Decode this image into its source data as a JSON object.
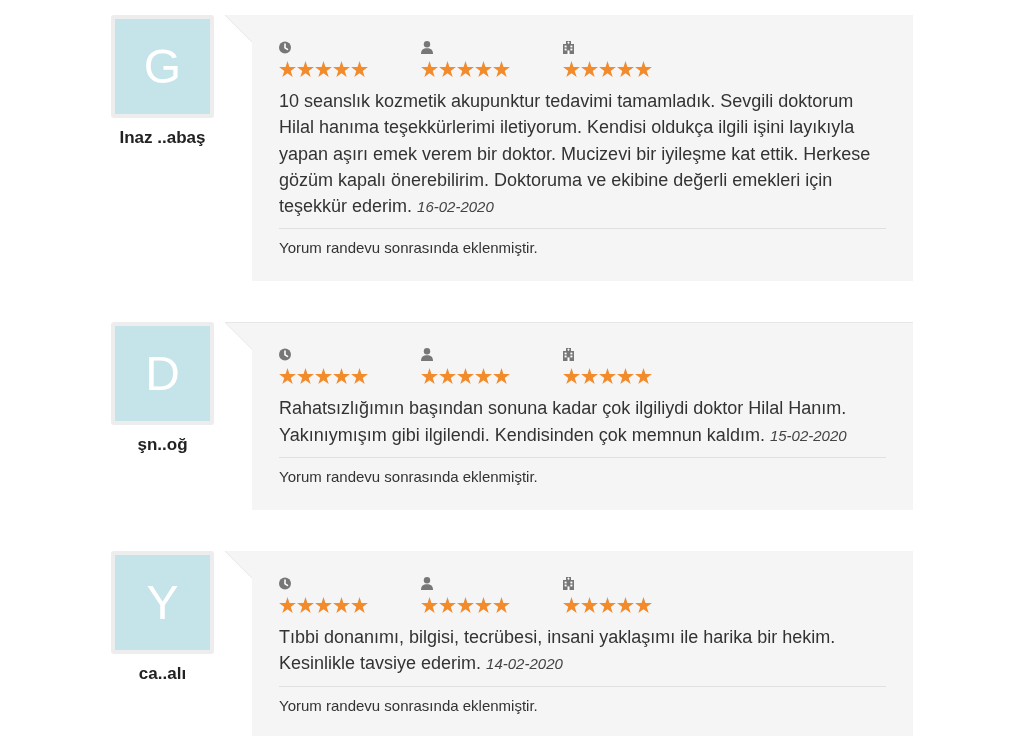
{
  "reviews": [
    {
      "avatar_letter": "G",
      "name": "Inaz ..abaş",
      "ratings": [
        {
          "kind": "clock",
          "stars": 5
        },
        {
          "kind": "person",
          "stars": 5
        },
        {
          "kind": "building",
          "stars": 5
        }
      ],
      "text": "10 seanslık kozmetik akupunktur tedavimi tamamladık. Sevgili doktorum Hilal hanıma teşekkürlerimi iletiyorum. Kendisi oldukça ilgili işini layıkıyla yapan aşırı emek verem bir doktor. Mucizevi bir iyileşme kat ettik. Herkese gözüm kapalı önerebilirim. Doktoruma ve ekibine değerli emekleri için teşekkür ederim. *16-02-2020*",
      "note": "Yorum randevu sonrasında eklenmiştir."
    },
    {
      "avatar_letter": "D",
      "name": "şn..oğ",
      "ratings": [
        {
          "kind": "clock",
          "stars": 5
        },
        {
          "kind": "person",
          "stars": 5
        },
        {
          "kind": "building",
          "stars": 5
        }
      ],
      "text": "Rahatsızlığımın başından sonuna kadar çok ilgiliydi doktor Hilal Hanım. Yakınıymışım gibi ilgilendi. Kendisinden çok memnun kaldım. *15-02-2020*",
      "note": "Yorum randevu sonrasında eklenmiştir."
    },
    {
      "avatar_letter": "Y",
      "name": "ca..alı",
      "ratings": [
        {
          "kind": "clock",
          "stars": 5
        },
        {
          "kind": "person",
          "stars": 5
        },
        {
          "kind": "building",
          "stars": 5
        }
      ],
      "text": "Tıbbi donanımı, bilgisi, tecrübesi, insani yaklaşımı ile harika bir hekim. Kesinlikle tavsiye ederim. *14-02-2020*",
      "note": "Yorum randevu sonrasında eklenmiştir."
    }
  ]
}
